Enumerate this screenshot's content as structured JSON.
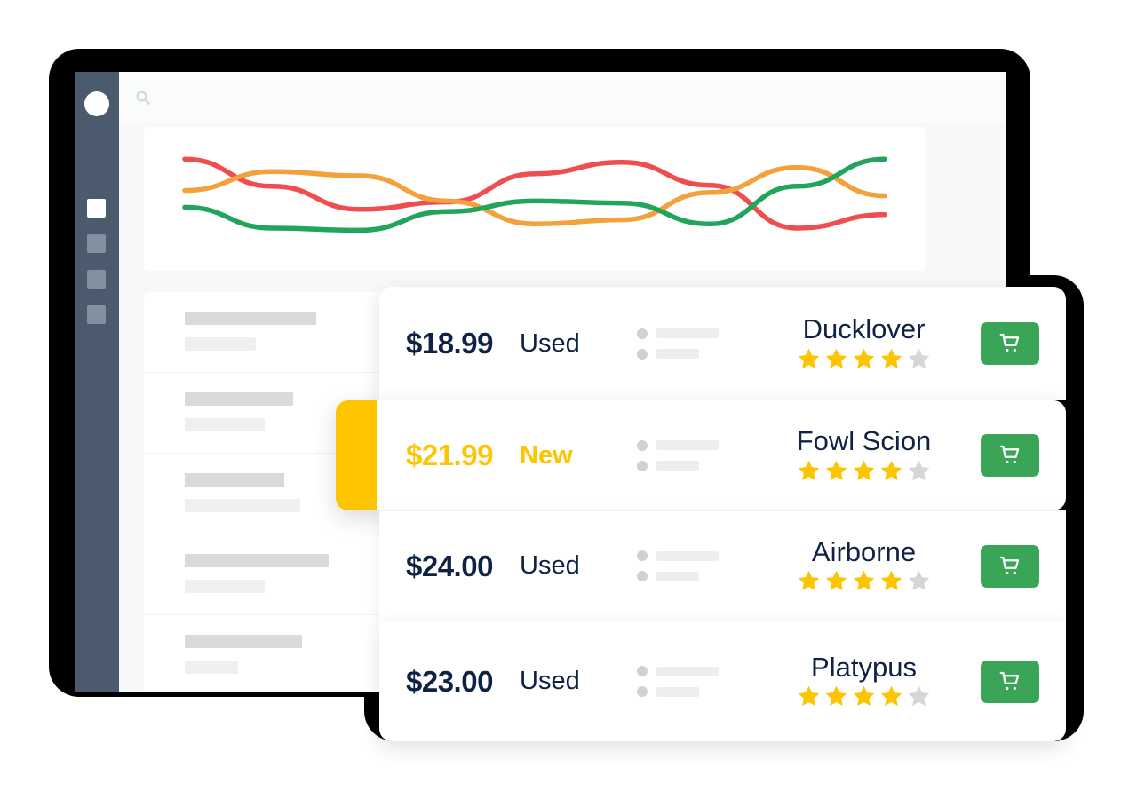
{
  "device": {
    "sidebar": {
      "avatar_icon": "avatar-circle-icon",
      "items": [
        {
          "icon": "nav-square-icon",
          "active": true
        },
        {
          "icon": "nav-square-icon",
          "active": false
        },
        {
          "icon": "nav-square-icon",
          "active": false
        },
        {
          "icon": "nav-square-icon",
          "active": false
        }
      ]
    },
    "topbar": {
      "search_icon": "search-icon"
    },
    "skeleton_rows": [
      {
        "wide_width": 148,
        "narrow_width": 80
      },
      {
        "wide_width": 122,
        "narrow_width": 90
      },
      {
        "wide_width": 112,
        "narrow_width": 130
      },
      {
        "wide_width": 162,
        "narrow_width": 90
      },
      {
        "wide_width": 132,
        "narrow_width": 60
      }
    ]
  },
  "colors": {
    "bezel": "#000000",
    "sidebar": "#4c5a6e",
    "page_bg": "#f7f8f9",
    "navy": "#0f2244",
    "accent_yellow": "#fdc500",
    "star_gold": "#fdc500",
    "star_empty": "#d4d6d8",
    "cart_green": "#3aa457",
    "line_red": "#ef4e50",
    "line_orange": "#f2a13c",
    "line_green": "#22a45d"
  },
  "chart_data": {
    "type": "line",
    "title": "",
    "xlabel": "",
    "ylabel": "",
    "grid": false,
    "legend": "none",
    "x": [
      0,
      1,
      2,
      3,
      4,
      5,
      6,
      7,
      8
    ],
    "ylim": [
      0,
      100
    ],
    "series": [
      {
        "name": "red",
        "color": "#ef4e50",
        "values": [
          88,
          62,
          40,
          47,
          74,
          85,
          63,
          22,
          35
        ]
      },
      {
        "name": "orange",
        "color": "#f2a13c",
        "values": [
          58,
          76,
          72,
          48,
          26,
          30,
          56,
          80,
          53
        ]
      },
      {
        "name": "green",
        "color": "#22a45d",
        "values": [
          42,
          22,
          20,
          38,
          48,
          46,
          26,
          62,
          88
        ]
      }
    ]
  },
  "products": [
    {
      "price": "$18.99",
      "condition": "Used",
      "title": "Ducklover",
      "rating": 4,
      "max_rating": 5,
      "highlighted": false,
      "cart_icon": "shopping-cart-icon"
    },
    {
      "price": "$21.99",
      "condition": "New",
      "title": "Fowl Scion",
      "rating": 4,
      "max_rating": 5,
      "highlighted": true,
      "cart_icon": "shopping-cart-icon"
    },
    {
      "price": "$24.00",
      "condition": "Used",
      "title": "Airborne",
      "rating": 4,
      "max_rating": 5,
      "highlighted": false,
      "cart_icon": "shopping-cart-icon"
    },
    {
      "price": "$23.00",
      "condition": "Used",
      "title": "Platypus",
      "rating": 4,
      "max_rating": 5,
      "highlighted": false,
      "cart_icon": "shopping-cart-icon"
    }
  ]
}
